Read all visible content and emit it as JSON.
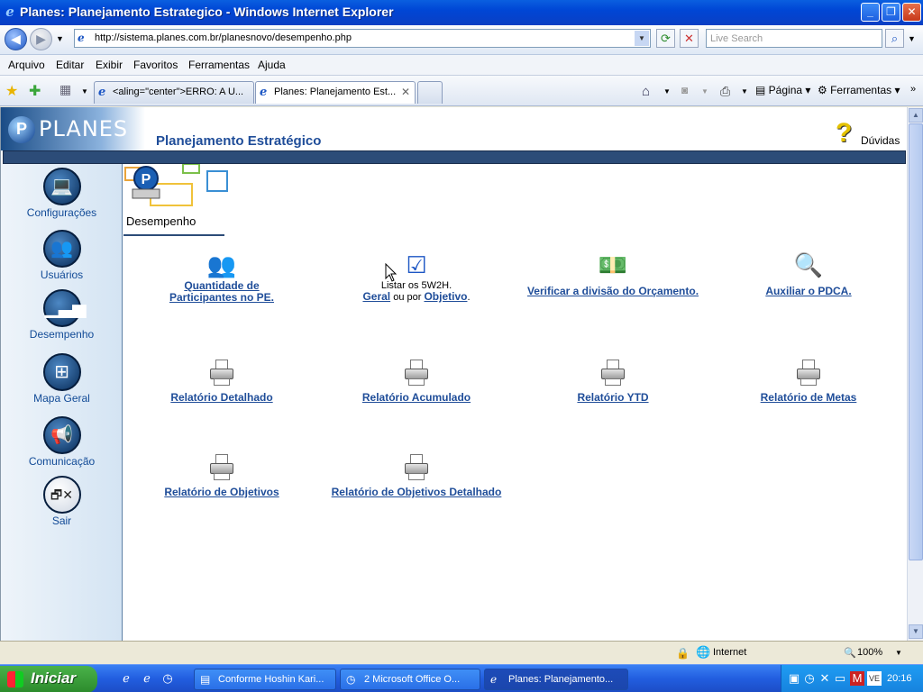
{
  "window": {
    "title": "Planes: Planejamento Estrategico - Windows Internet Explorer",
    "minimize": "_",
    "maximize": "❐",
    "close": "✕"
  },
  "address": {
    "url": "http://sistema.planes.com.br/planesnovo/desempenho.php",
    "search_placeholder": "Live Search"
  },
  "menu": [
    "Arquivo",
    "Editar",
    "Exibir",
    "Favoritos",
    "Ferramentas",
    "Ajuda"
  ],
  "tabs": [
    {
      "label": "<aling=\"center\">ERRO: A U..."
    },
    {
      "label": "Planes: Planejamento Est..."
    }
  ],
  "commands": {
    "page": "Página",
    "tools": "Ferramentas"
  },
  "header": {
    "logo": "PLANES",
    "title": "Planejamento Estratégico",
    "help": "Dúvidas"
  },
  "sidebar": [
    {
      "label": "Configurações",
      "icon": "laptop-icon"
    },
    {
      "label": "Usuários",
      "icon": "users-icon"
    },
    {
      "label": "Desempenho",
      "icon": "chart-icon"
    },
    {
      "label": "Mapa Geral",
      "icon": "flowchart-icon"
    },
    {
      "label": "Comunicação",
      "icon": "megaphone-icon"
    },
    {
      "label": "Sair",
      "icon": "exit-icon"
    }
  ],
  "section": {
    "label": "Desempenho"
  },
  "items": {
    "participants": {
      "line1": "Quantidade de",
      "line2": "Participantes no PE."
    },
    "w2h": {
      "prefix": "Listar os 5W2H.",
      "geral": "Geral",
      "middle": " ou por ",
      "objetivo": "Objetivo",
      "suffix": "."
    },
    "orcamento": "Verificar a divisão do Orçamento.",
    "pdca": "Auxiliar o PDCA.",
    "rel_detalhado": "Relatório Detalhado",
    "rel_acumulado": "Relatório Acumulado",
    "rel_ytd": "Relatório YTD",
    "rel_metas": "Relatório de Metas",
    "rel_objetivos": "Relatório de Objetivos",
    "rel_obj_det": "Relatório de Objetivos Detalhado"
  },
  "status": {
    "zone": "Internet",
    "zoom": "100%"
  },
  "taskbar": {
    "start": "Iniciar",
    "tasks": [
      {
        "label": "Conforme Hoshin Kari..."
      },
      {
        "label": "2 Microsoft Office O..."
      },
      {
        "label": "Planes: Planejamento..."
      }
    ],
    "clock": "20:16"
  }
}
